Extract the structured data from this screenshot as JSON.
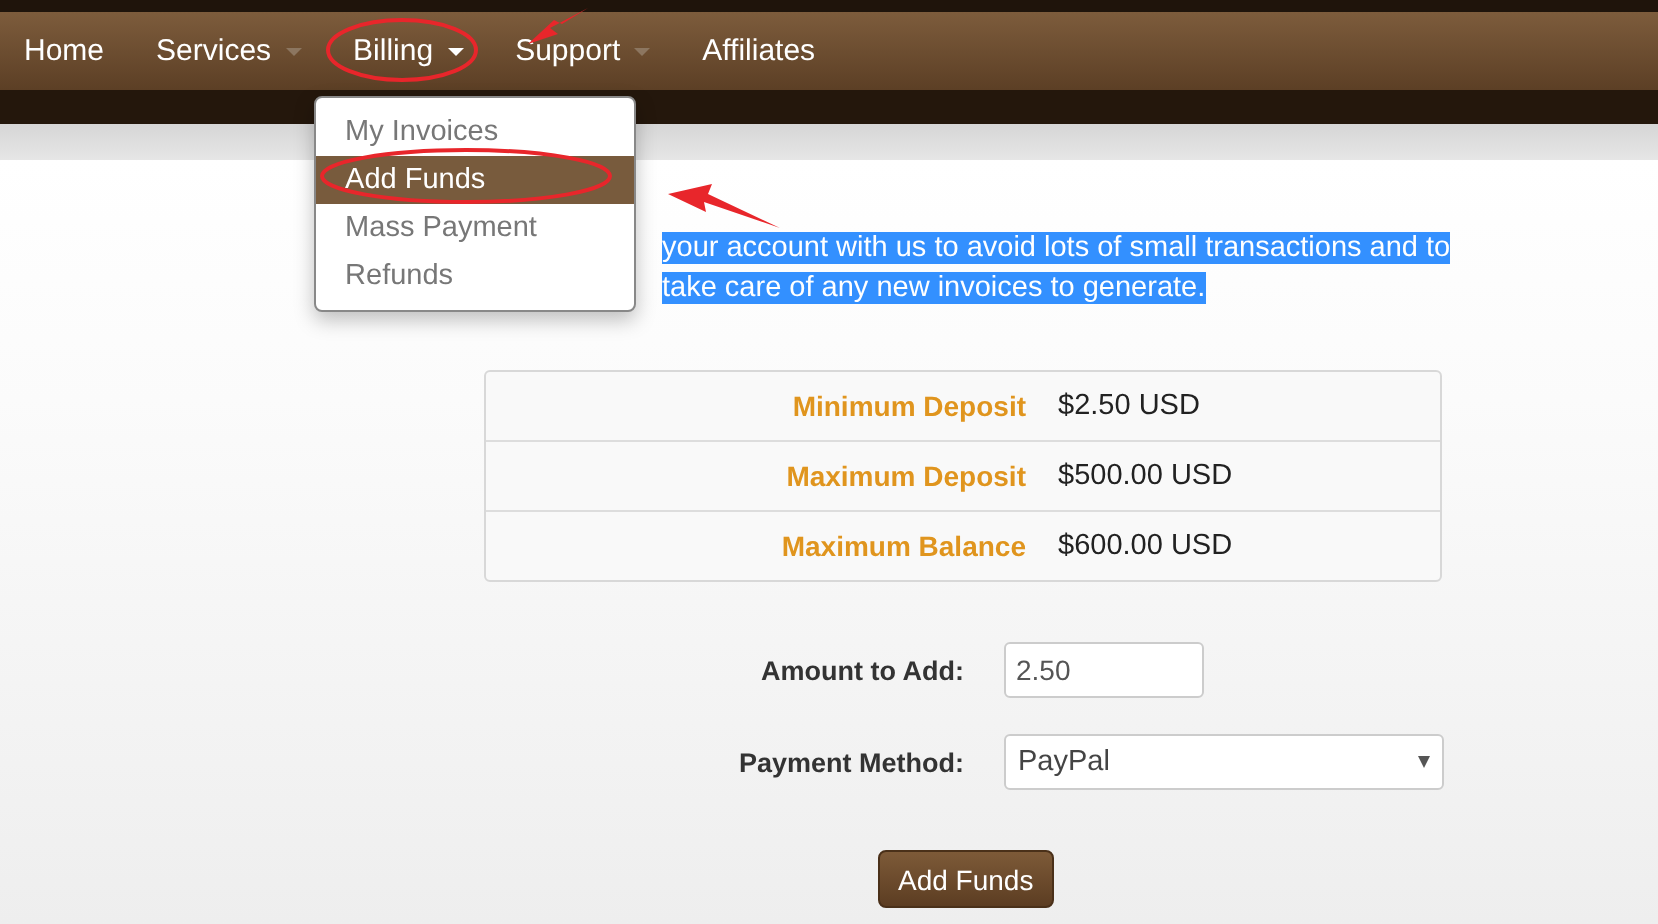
{
  "nav": {
    "items": [
      {
        "label": "Home",
        "has_menu": false
      },
      {
        "label": "Services",
        "has_menu": true,
        "open": false
      },
      {
        "label": "Billing",
        "has_menu": true,
        "open": true
      },
      {
        "label": "Support",
        "has_menu": true,
        "open": false
      },
      {
        "label": "Affiliates",
        "has_menu": false
      }
    ]
  },
  "dropdown": {
    "items": [
      {
        "label": "My Invoices",
        "selected": false
      },
      {
        "label": "Add Funds",
        "selected": true
      },
      {
        "label": "Mass Payment",
        "selected": false
      },
      {
        "label": "Refunds",
        "selected": false
      }
    ]
  },
  "intro": {
    "text": "your account with us to avoid lots of small transactions and to take care of any new invoices to generate.",
    "selected": true
  },
  "limits": [
    {
      "label": "Minimum Deposit",
      "value": "$2.50 USD"
    },
    {
      "label": "Maximum Deposit",
      "value": "$500.00 USD"
    },
    {
      "label": "Maximum Balance",
      "value": "$600.00 USD"
    }
  ],
  "form": {
    "amount": {
      "label": "Amount to Add:",
      "value": "2.50"
    },
    "method": {
      "label": "Payment Method:",
      "value": "PayPal"
    },
    "submit": "Add Funds"
  }
}
